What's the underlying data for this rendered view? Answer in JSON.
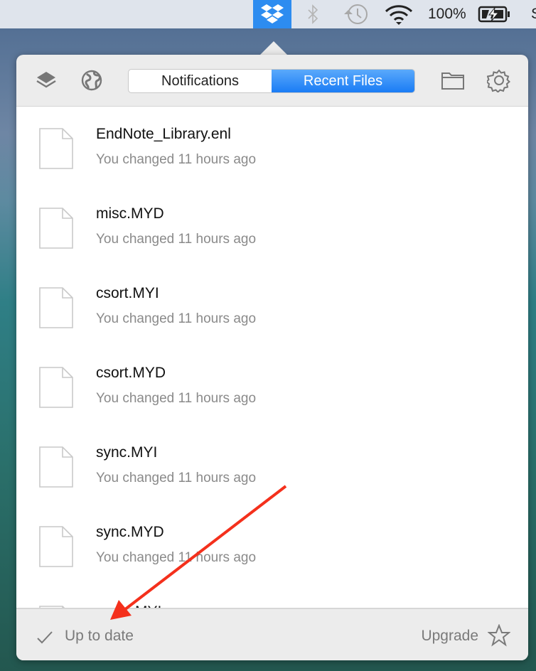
{
  "menubar": {
    "battery_percent": "100%",
    "icons": [
      "dropbox-icon",
      "bluetooth-icon",
      "time-machine-icon",
      "wifi-icon",
      "battery-charging-icon"
    ],
    "edge_text": "S"
  },
  "header": {
    "tabs": [
      {
        "label": "Notifications",
        "active": false
      },
      {
        "label": "Recent Files",
        "active": true
      }
    ],
    "icons": [
      "layers-icon",
      "globe-icon",
      "folder-icon",
      "gear-icon"
    ],
    "accent": "#1a7cf5"
  },
  "files": [
    {
      "name": "EndNote_Library.enl",
      "status": "You changed 11 hours ago"
    },
    {
      "name": "misc.MYD",
      "status": "You changed 11 hours ago"
    },
    {
      "name": "csort.MYI",
      "status": "You changed 11 hours ago"
    },
    {
      "name": "csort.MYD",
      "status": "You changed 11 hours ago"
    },
    {
      "name": "sync.MYI",
      "status": "You changed 11 hours ago"
    },
    {
      "name": "sync.MYD",
      "status": "You changed 11 hours ago"
    },
    {
      "name": "MYI",
      "status": ""
    }
  ],
  "footer": {
    "status": "Up to date",
    "upgrade": "Upgrade"
  },
  "annotation": {
    "color": "#f4301c"
  }
}
